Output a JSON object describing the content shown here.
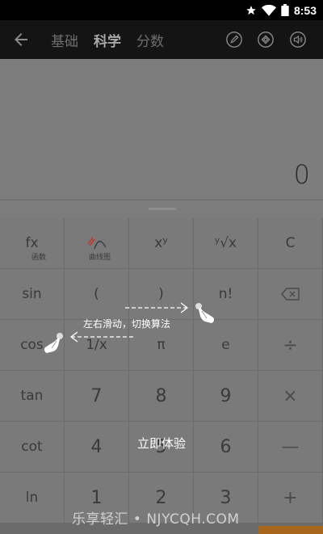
{
  "status": {
    "time": "8:53",
    "icons": [
      "star-icon",
      "wifi-icon",
      "battery-icon"
    ]
  },
  "app_bar": {
    "tabs": [
      {
        "label": "基础",
        "active": false
      },
      {
        "label": "科学",
        "active": true
      },
      {
        "label": "分数",
        "active": false
      }
    ],
    "icons": [
      "back-arrow-icon",
      "edit-icon",
      "theme-icon",
      "sound-icon"
    ]
  },
  "display": {
    "value": "0"
  },
  "keys": [
    {
      "name": "fx-key",
      "label": "fx",
      "sub": "函数"
    },
    {
      "name": "curve-key",
      "label": "",
      "sub": "曲线图"
    },
    {
      "name": "power-key",
      "label": "xʸ",
      "sub": ""
    },
    {
      "name": "root-key",
      "label": "ʸ√x",
      "sub": ""
    },
    {
      "name": "clear-key",
      "label": "C",
      "sub": ""
    },
    {
      "name": "sin-key",
      "label": "sin",
      "sub": ""
    },
    {
      "name": "open-paren-key",
      "label": "(",
      "sub": ""
    },
    {
      "name": "close-paren-key",
      "label": ")",
      "sub": ""
    },
    {
      "name": "factorial-key",
      "label": "n!",
      "sub": ""
    },
    {
      "name": "backspace-key",
      "label": "",
      "sub": ""
    },
    {
      "name": "cos-key",
      "label": "cos",
      "sub": ""
    },
    {
      "name": "reciprocal-key",
      "label": "1/x",
      "sub": ""
    },
    {
      "name": "pi-key",
      "label": "π",
      "sub": ""
    },
    {
      "name": "e-key",
      "label": "e",
      "sub": ""
    },
    {
      "name": "divide-key",
      "label": "÷",
      "sub": ""
    },
    {
      "name": "tan-key",
      "label": "tan",
      "sub": ""
    },
    {
      "name": "seven-key",
      "label": "7",
      "sub": ""
    },
    {
      "name": "eight-key",
      "label": "8",
      "sub": ""
    },
    {
      "name": "nine-key",
      "label": "9",
      "sub": ""
    },
    {
      "name": "multiply-key",
      "label": "×",
      "sub": ""
    },
    {
      "name": "cot-key",
      "label": "cot",
      "sub": ""
    },
    {
      "name": "four-key",
      "label": "4",
      "sub": ""
    },
    {
      "name": "five-key",
      "label": "5",
      "sub": ""
    },
    {
      "name": "six-key",
      "label": "6",
      "sub": ""
    },
    {
      "name": "minus-key",
      "label": "—",
      "sub": ""
    },
    {
      "name": "ln-key",
      "label": "ln",
      "sub": ""
    },
    {
      "name": "one-key",
      "label": "1",
      "sub": ""
    },
    {
      "name": "two-key",
      "label": "2",
      "sub": ""
    },
    {
      "name": "three-key",
      "label": "3",
      "sub": ""
    },
    {
      "name": "plus-key",
      "label": "+",
      "sub": ""
    }
  ],
  "overlay": {
    "hint": "左右滑动，切换算法",
    "try_now": "立即体验"
  },
  "watermark": "乐享轻汇 • NJYCQH.COM"
}
